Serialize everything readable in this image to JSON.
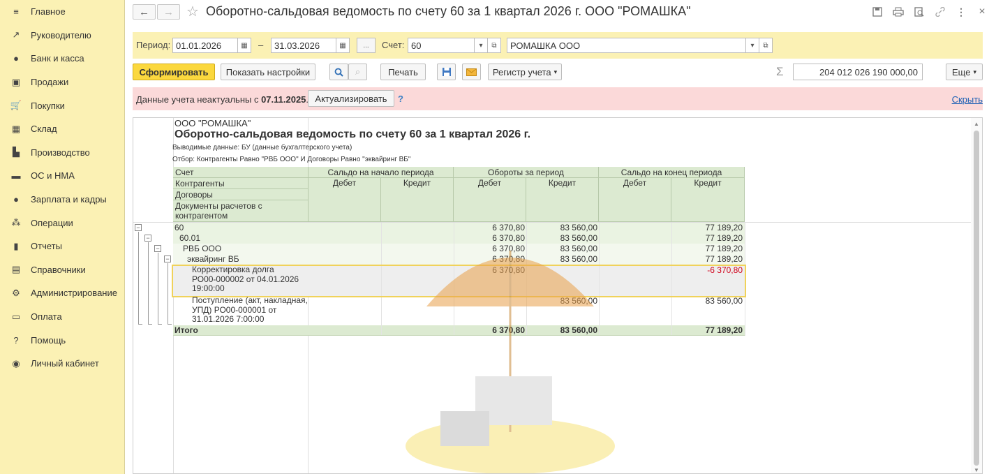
{
  "sidebar": {
    "items": [
      {
        "label": "Главное",
        "icon": "menu-icon",
        "glyph": "≡"
      },
      {
        "label": "Руководителю",
        "icon": "trend-icon",
        "glyph": "↗"
      },
      {
        "label": "Банк и касса",
        "icon": "coin-icon",
        "glyph": "●"
      },
      {
        "label": "Продажи",
        "icon": "bag-icon",
        "glyph": "▣"
      },
      {
        "label": "Покупки",
        "icon": "cart-icon",
        "glyph": "🛒"
      },
      {
        "label": "Склад",
        "icon": "grid-icon",
        "glyph": "▦"
      },
      {
        "label": "Производство",
        "icon": "factory-icon",
        "glyph": "▙"
      },
      {
        "label": "ОС и НМА",
        "icon": "truck-icon",
        "glyph": "▬"
      },
      {
        "label": "Зарплата и кадры",
        "icon": "person-icon",
        "glyph": "●"
      },
      {
        "label": "Операции",
        "icon": "operations-icon",
        "glyph": "⁂"
      },
      {
        "label": "Отчеты",
        "icon": "bar-chart-icon",
        "glyph": "▮"
      },
      {
        "label": "Справочники",
        "icon": "book-icon",
        "glyph": "▤"
      },
      {
        "label": "Администрирование",
        "icon": "gear-icon",
        "glyph": "⚙"
      },
      {
        "label": "Оплата",
        "icon": "payment-icon",
        "glyph": "▭"
      },
      {
        "label": "Помощь",
        "icon": "help-icon",
        "glyph": "?"
      },
      {
        "label": "Личный кабинет",
        "icon": "account-icon",
        "glyph": "◉"
      }
    ]
  },
  "title": {
    "back": "←",
    "forward": "→",
    "star": "☆",
    "text": "Оборотно-сальдовая ведомость по счету 60 за 1 квартал 2026 г. ООО \"РОМАШКА\""
  },
  "params": {
    "period_label": "Период:",
    "date_from": "01.01.2026",
    "dash": "–",
    "date_to": "31.03.2026",
    "ellipsis": "...",
    "account_label": "Счет:",
    "account": "60",
    "organization": "РОМАШКА ООО"
  },
  "toolbar": {
    "generate": "Сформировать",
    "settings": "Показать настройки",
    "print": "Печать",
    "register": "Регистр учета",
    "sigma": "Σ",
    "sum": "204 012 026 190 000,00",
    "more": "Еще"
  },
  "alert": {
    "text_prefix": "Данные учета неактуальны с ",
    "date": "07.11.2025",
    "text_suffix": ".",
    "action": "Актуализировать",
    "help": "?",
    "hide": "Скрыть"
  },
  "report": {
    "org": "ООО \"РОМАШКА\"",
    "title": "Оборотно-сальдовая ведомость по счету 60 за 1 квартал 2026 г.",
    "output_data": "Выводимые данные: БУ (данные бухгалтерского учета)",
    "filter": "Отбор: Контрагенты Равно \"РВБ ООО\" И Договоры Равно \"эквайринг ВБ\"",
    "headers": {
      "account": "Счет",
      "counterparties": "Контрагенты",
      "contracts": "Договоры",
      "documents": "Документы расчетов с контрагентом",
      "opening": "Сальдо на начало периода",
      "turnover": "Обороты за период",
      "closing": "Сальдо на конец периода",
      "debit": "Дебет",
      "credit": "Кредит"
    },
    "rows": [
      {
        "name": "60",
        "turn_debit": "6 370,80",
        "turn_credit": "83 560,00",
        "close_credit": "77 189,20"
      },
      {
        "name": "60.01",
        "turn_debit": "6 370,80",
        "turn_credit": "83 560,00",
        "close_credit": "77 189,20"
      },
      {
        "name": "РВБ ООО",
        "turn_debit": "6 370,80",
        "turn_credit": "83 560,00",
        "close_credit": "77 189,20"
      },
      {
        "name": "эквайринг ВБ",
        "turn_debit": "6 370,80",
        "turn_credit": "83 560,00",
        "close_credit": "77 189,20"
      },
      {
        "name_lines": [
          "Корректировка долга",
          "РО00-000002 от 04.01.2026",
          "19:00:00"
        ],
        "turn_debit": "6 370,80",
        "turn_credit": "",
        "close_credit": "-6 370,80"
      },
      {
        "name_lines": [
          "Поступление (акт, накладная,",
          "УПД) РО00-000001 от",
          "31.01.2026 7:00:00"
        ],
        "turn_debit": "",
        "turn_credit": "83 560,00",
        "close_credit": "83 560,00"
      }
    ],
    "total": {
      "name": "Итого",
      "turn_debit": "6 370,80",
      "turn_credit": "83 560,00",
      "close_credit": "77 189,20"
    }
  },
  "colors": {
    "sidebar_bg": "#fbf1b4",
    "header_green": "#dcead1",
    "row_green": "#eaf3e2",
    "row_light": "#f3f8ee",
    "selected_border": "#f0d25a",
    "negative": "#d0021b",
    "link": "#1a5fb4"
  }
}
